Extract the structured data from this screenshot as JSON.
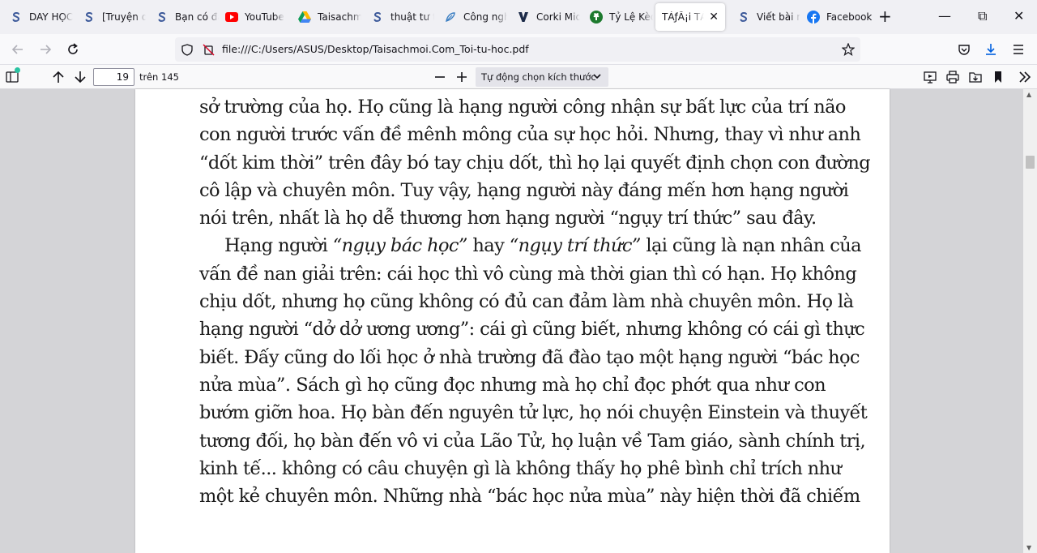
{
  "tabs": [
    {
      "label": "DAY HỌC",
      "icon": "s-logo-icon"
    },
    {
      "label": "[Truyện dài]",
      "icon": "s-logo-icon"
    },
    {
      "label": "Bạn có đang",
      "icon": "s-logo-icon"
    },
    {
      "label": "YouTube",
      "icon": "youtube-icon"
    },
    {
      "label": "Taisachmoi",
      "icon": "google-drive-icon"
    },
    {
      "label": "thuật tư tưởng",
      "icon": "s-logo-icon"
    },
    {
      "label": "Công nghệ",
      "icon": "feather-icon"
    },
    {
      "label": "Corki Mid",
      "icon": "v-logo-icon"
    },
    {
      "label": "Tỷ Lệ Kèo",
      "icon": "shamrock-icon"
    },
    {
      "label": "TẢƒÂ¡i TẢƒÂ¡i",
      "icon": "none",
      "active": true
    },
    {
      "label": "Viết bài mới",
      "icon": "s-logo-icon"
    },
    {
      "label": "Facebook",
      "icon": "facebook-icon"
    }
  ],
  "window": {
    "new_tab": "+",
    "minimize": "—",
    "maximize": "⧉",
    "close": "✕"
  },
  "nav": {
    "url": "file:///C:/Users/ASUS/Desktop/Taisachmoi.Com_Toi-tu-hoc.pdf"
  },
  "pdf_toolbar": {
    "page_number": "19",
    "page_count_label": "trên 145",
    "zoom_label": "Tự động chọn kích thước"
  },
  "document": {
    "lines": [
      {
        "text": "sở trường của họ. Họ cũng là hạng người công nhận sự bất lực của trí não"
      },
      {
        "text": "con người trước vấn đề mênh mông của sự học hỏi. Nhưng, thay vì như anh"
      },
      {
        "text": "“dốt kim thời” trên đây bó tay chịu dốt, thì họ lại quyết định chọn con đường"
      },
      {
        "text": "cô lập và chuyên môn. Tuy vậy, hạng người này đáng mến hơn hạng người"
      },
      {
        "text": "nói trên, nhất là họ dễ thương hơn hạng người “ngụy trí thức” sau đây."
      },
      {
        "pre": "Hạng người ",
        "em1": "“ngụy bác học”",
        "mid": " hay ",
        "em2": "“ngụy trí thức”",
        "post": " lại cũng là nạn nhân của"
      },
      {
        "text": "vấn đề nan giải trên: cái học thì vô cùng mà thời gian thì có hạn. Họ không"
      },
      {
        "text": "chịu dốt, nhưng họ cũng không có đủ can đảm làm nhà chuyên môn. Họ là"
      },
      {
        "text": "hạng người “dở dở ương ương”: cái gì cũng biết, nhưng không có cái gì thực"
      },
      {
        "text": "biết. Đấy cũng do lối học ở nhà trường đã đào tạo một hạng người “bác học"
      },
      {
        "text": "nửa mùa”. Sách gì họ cũng đọc nhưng mà họ chỉ đọc phớt qua như con"
      },
      {
        "text": "bướm giỡn hoa. Họ bàn đến nguyên tử lực, họ nói chuyện Einstein và thuyết"
      },
      {
        "text": "tương đối, họ bàn đến vô vi của Lão Tử, họ luận về Tam giáo, sành chính trị,"
      },
      {
        "text": "kinh tế... không có câu chuyện gì là không thấy họ phê bình chỉ trích như"
      },
      {
        "text": "một kẻ chuyên môn. Những nhà “bác học nửa mùa” này hiện thời đã chiếm"
      }
    ]
  }
}
